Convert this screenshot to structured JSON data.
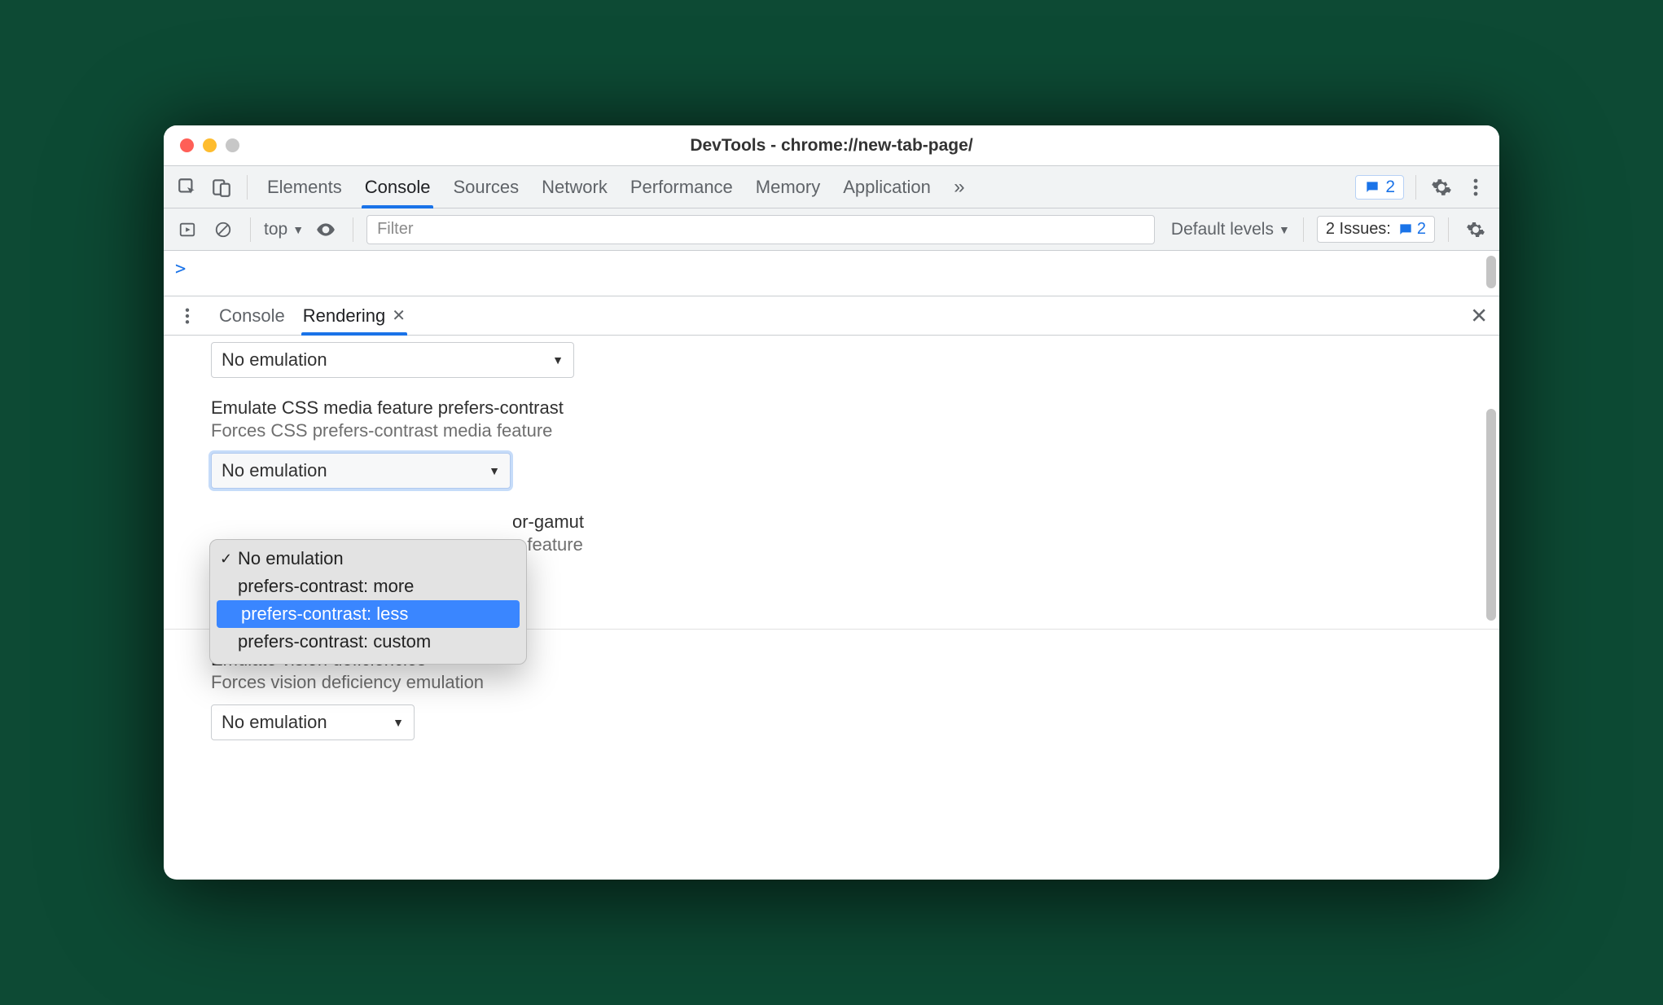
{
  "window": {
    "title": "DevTools - chrome://new-tab-page/"
  },
  "mainTabs": {
    "items": [
      "Elements",
      "Console",
      "Sources",
      "Network",
      "Performance",
      "Memory",
      "Application"
    ],
    "activeIndex": 1,
    "overflow": "»"
  },
  "toolbarRight": {
    "messageBadgeCount": "2"
  },
  "consoleToolbar": {
    "contextLabel": "top",
    "filterPlaceholder": "Filter",
    "levelsLabel": "Default levels",
    "issuesLabel": "2 Issues:",
    "issuesCount": "2"
  },
  "consolePrompt": ">",
  "drawer": {
    "tabs": [
      "Console",
      "Rendering"
    ],
    "activeIndex": 1
  },
  "rendering": {
    "topSelectValue": "No emulation",
    "contrast": {
      "title": "Emulate CSS media feature prefers-contrast",
      "subtitle": "Forces CSS prefers-contrast media feature",
      "selectValue": "No emulation",
      "options": [
        "No emulation",
        "prefers-contrast: more",
        "prefers-contrast: less",
        "prefers-contrast: custom"
      ],
      "checkedIndex": 0,
      "highlightIndex": 2
    },
    "colorGamut": {
      "titlePartial": "or-gamut",
      "subtitlePartial": "a feature"
    },
    "vision": {
      "title": "Emulate vision deficiencies",
      "subtitle": "Forces vision deficiency emulation",
      "selectValue": "No emulation"
    }
  }
}
